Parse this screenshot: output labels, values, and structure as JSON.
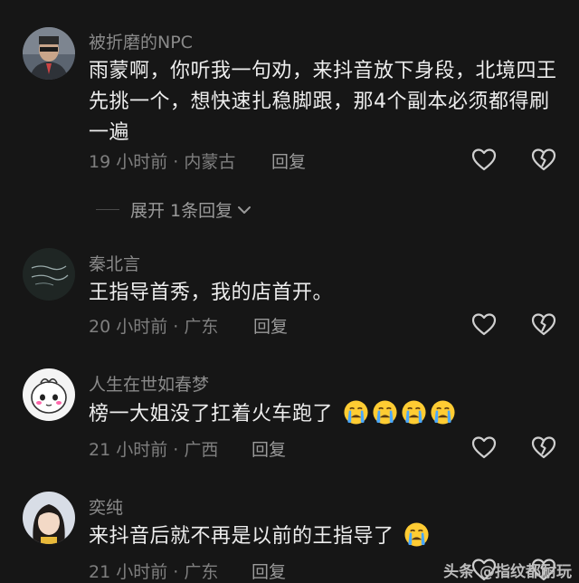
{
  "comments": [
    {
      "username": "被折磨的NPC",
      "text": "雨蒙啊，你听我一句劝，来抖音放下身段，北境四王先挑一个，想快速扎稳脚跟，那4个副本必须都得刷一遍",
      "meta": "19 小时前 · 内蒙古",
      "reply_label": "回复"
    },
    {
      "username": "秦北言",
      "text": "王指导首秀，我的店首开。",
      "meta": "20 小时前 · 广东",
      "reply_label": "回复"
    },
    {
      "username": "人生在世如春梦",
      "text": "榜一大姐没了扛着火车跑了",
      "meta": "21 小时前 · 广西",
      "reply_label": "回复"
    },
    {
      "username": "奕纯",
      "text": "来抖音后就不再是以前的王指导了",
      "meta": "21 小时前 · 广东",
      "reply_label": "回复"
    }
  ],
  "expand_replies": "展开 1条回复",
  "icons": {
    "like": "heart-icon",
    "dislike": "broken-heart-icon",
    "emoji": "loudly-crying-face-emoji",
    "expand": "chevron-down-icon"
  },
  "watermark": "头条 @指纹都耐玩"
}
